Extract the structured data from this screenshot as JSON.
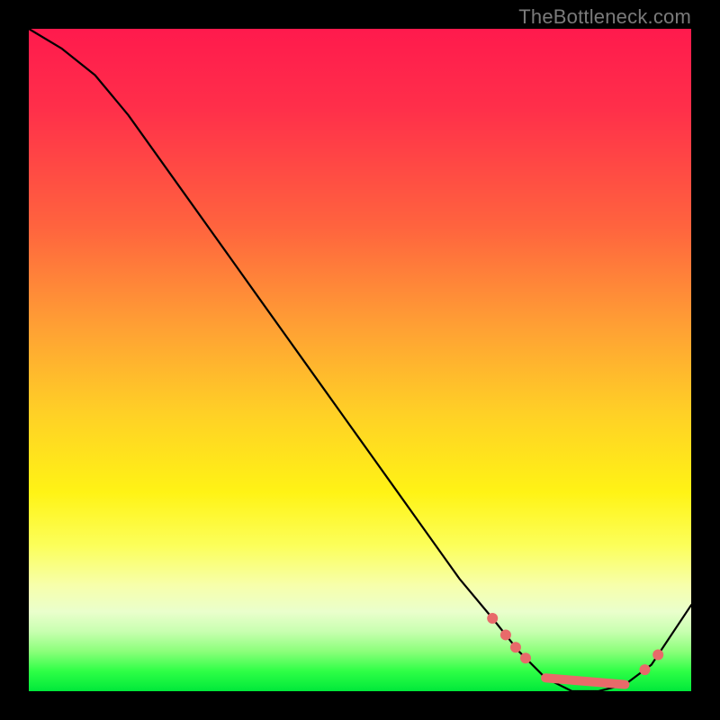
{
  "watermark": "TheBottleneck.com",
  "colors": {
    "frame": "#000000",
    "curve": "#000000",
    "marker": "#e86a6a"
  },
  "chart_data": {
    "type": "line",
    "title": "",
    "xlabel": "",
    "ylabel": "",
    "xlim": [
      0,
      100
    ],
    "ylim": [
      0,
      100
    ],
    "grid": false,
    "legend": false,
    "series": [
      {
        "name": "bottleneck-curve",
        "x": [
          0,
          5,
          10,
          15,
          20,
          25,
          30,
          35,
          40,
          45,
          50,
          55,
          60,
          65,
          70,
          74,
          78,
          82,
          86,
          90,
          94,
          100
        ],
        "y": [
          100,
          97,
          93,
          87,
          80,
          73,
          66,
          59,
          52,
          45,
          38,
          31,
          24,
          17,
          11,
          6,
          2,
          0,
          0,
          1,
          4,
          13
        ]
      }
    ],
    "markers": {
      "left_cluster_x": [
        70,
        72,
        73.5,
        75
      ],
      "flat_segment_x": [
        78,
        90
      ],
      "right_cluster_x": [
        93,
        95
      ]
    },
    "background_gradient_stops": [
      {
        "pct": 0,
        "hex": "#ff1a4d"
      },
      {
        "pct": 30,
        "hex": "#ff643e"
      },
      {
        "pct": 58,
        "hex": "#ffd026"
      },
      {
        "pct": 78,
        "hex": "#fcff5a"
      },
      {
        "pct": 94,
        "hex": "#8bff7a"
      },
      {
        "pct": 100,
        "hex": "#00e83a"
      }
    ]
  }
}
